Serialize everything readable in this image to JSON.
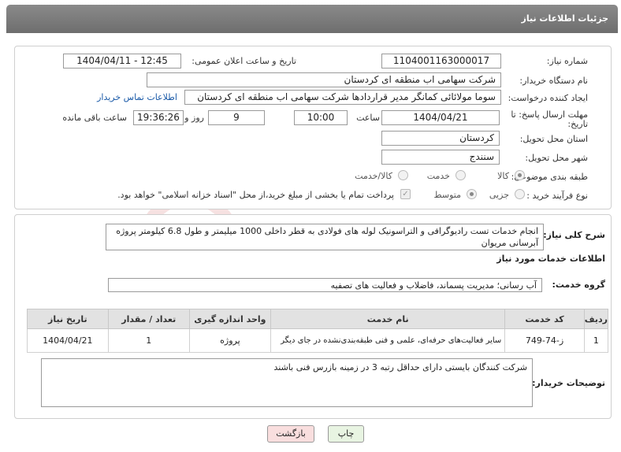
{
  "header": {
    "title": "جزئیات اطلاعات نیاز"
  },
  "fields": {
    "need_number_label": "شماره نیاز:",
    "need_number": "1104001163000017",
    "announce_label": "تاریخ و ساعت اعلان عمومی:",
    "announce_value": "1404/04/11 - 12:45",
    "buyer_org_label": "نام دستگاه خریدار:",
    "buyer_org": "شرکت سهامی اب منطقه ای کردستان",
    "requester_label": "ایجاد کننده درخواست:",
    "requester": "سوما مولائائی کمانگر مدیر قراردادها شرکت سهامی اب منطقه ای کردستان",
    "contact_link": "اطلاعات تماس خریدار",
    "deadline_label_1": "مهلت ارسال پاسخ: تا",
    "deadline_label_2": "تاریخ:",
    "deadline_date": "1404/04/21",
    "time_label": "ساعت",
    "deadline_time": "10:00",
    "days_value": "9",
    "days_label": "روز و",
    "remaining_time": "19:36:26",
    "remaining_label": "ساعت باقی مانده",
    "province_label": "استان محل تحویل:",
    "province": "کردستان",
    "city_label": "شهر محل تحویل:",
    "city": "سنندج",
    "category_label": "طبقه بندی موضوعی:",
    "category_options": [
      "کالا",
      "خدمت",
      "کالا/خدمت"
    ],
    "category_selected": "خدمت",
    "process_label": "نوع فرآیند خرید :",
    "process_options": [
      "جزیی",
      "متوسط"
    ],
    "process_selected": "متوسط",
    "payment_note": "پرداخت تمام یا بخشی از مبلغ خرید،از محل \"اسناد خزانه اسلامی\" خواهد بود."
  },
  "summary": {
    "label": "شرح کلی نیاز:",
    "text": "انجام خدمات تست رادیوگرافی و التراسونیک لوله های فولادی به قطر داخلی 1000 میلیمتر و طول 6.8 کیلومتر پروژه آبرسانی مریوان"
  },
  "services": {
    "section_title": "اطلاعات خدمات مورد نیاز",
    "group_label": "گروه خدمت:",
    "group_value": "آب رسانی؛ مدیریت پسماند، فاضلاب و فعالیت های تصفیه",
    "table": {
      "headers": [
        "ردیف",
        "کد خدمت",
        "نام خدمت",
        "واحد اندازه گیری",
        "تعداد / مقدار",
        "تاریخ نیاز"
      ],
      "rows": [
        [
          "1",
          "ز-74-749",
          "سایر فعالیت‌های حرفه‌ای، علمی و فنی طبقه‌بندی‌نشده در جای دیگر",
          "پروژه",
          "1",
          "1404/04/21"
        ]
      ]
    }
  },
  "buyer_notes": {
    "label": "توضیحات خریدار:",
    "text": "شرکت کنندگان بایستی دارای حداقل رتبه 3 در زمینه بازرس فنی باشند"
  },
  "buttons": {
    "print": "چاپ",
    "back": "بازگشت"
  },
  "watermark": {
    "text": "AriaTender.neT"
  },
  "colors": {
    "header_bg": "#7c7c7c",
    "link": "#1a5aa8",
    "back_button_bg": "#f9dede",
    "print_button_bg": "#e8f4e2"
  }
}
